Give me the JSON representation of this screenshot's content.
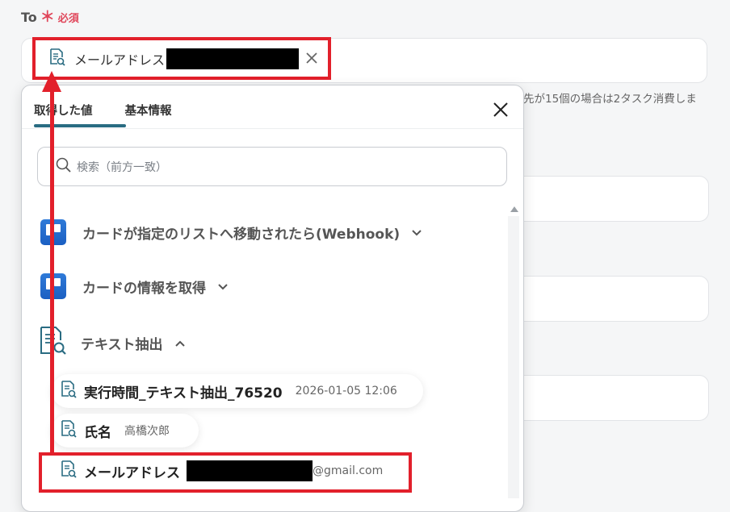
{
  "to_field": {
    "label": "To",
    "required_mark": "＊",
    "required_text": "必須",
    "chip_label": "メールアドレス"
  },
  "hint": "先が15個の場合は2タスク消費しま",
  "popup": {
    "tabs": [
      "取得した値",
      "基本情報"
    ],
    "search_placeholder": "検索（前方一致）",
    "sections": [
      {
        "title": "カードが指定のリストへ移動されたら(Webhook)",
        "icon": "trello-icon",
        "state": "collapsed"
      },
      {
        "title": "カードの情報を取得",
        "icon": "trello-icon",
        "state": "collapsed"
      },
      {
        "title": "テキスト抽出",
        "icon": "document-search-icon",
        "state": "expanded"
      }
    ],
    "items": [
      {
        "label": "実行時間_テキスト抽出_76520",
        "value": "2026-01-05 12:06"
      },
      {
        "label": "氏名",
        "value": "高橋次郎"
      },
      {
        "label": "メールアドレス",
        "value": "@gmail.com"
      }
    ]
  },
  "colors": {
    "accent": "#2a6c82",
    "required": "#e0475b",
    "highlight": "#e2202b",
    "trello": "#1b5fc2"
  }
}
